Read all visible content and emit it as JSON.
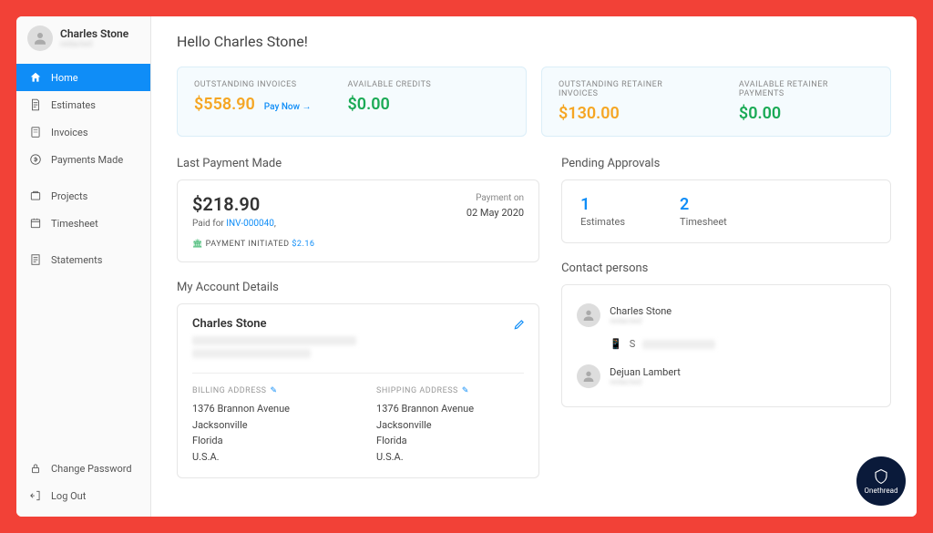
{
  "user": {
    "name": "Charles Stone",
    "subtitle": "—"
  },
  "nav": {
    "items": [
      {
        "label": "Home",
        "icon": "home",
        "active": true
      },
      {
        "label": "Estimates",
        "icon": "estimates"
      },
      {
        "label": "Invoices",
        "icon": "invoices"
      },
      {
        "label": "Payments Made",
        "icon": "payments"
      },
      {
        "label": "Projects",
        "icon": "projects"
      },
      {
        "label": "Timesheet",
        "icon": "timesheet"
      },
      {
        "label": "Statements",
        "icon": "statements"
      }
    ],
    "bottom": [
      {
        "label": "Change Password",
        "icon": "lock"
      },
      {
        "label": "Log Out",
        "icon": "logout"
      }
    ]
  },
  "greeting": "Hello Charles Stone!",
  "summary": {
    "card1": {
      "outstanding_label": "OUTSTANDING INVOICES",
      "outstanding_value": "$558.90",
      "paynow": "Pay Now →",
      "credits_label": "AVAILABLE CREDITS",
      "credits_value": "$0.00"
    },
    "card2": {
      "retainer_label": "OUTSTANDING RETAINER INVOICES",
      "retainer_value": "$130.00",
      "payments_label": "AVAILABLE RETAINER PAYMENTS",
      "payments_value": "$0.00"
    }
  },
  "last_payment": {
    "title": "Last Payment Made",
    "amount": "$218.90",
    "paid_for_prefix": "Paid for ",
    "paid_for_link": "INV-000040",
    "paid_for_suffix": ",",
    "initiated_label": "PAYMENT INITIATED",
    "initiated_amount": "$2.16",
    "payment_on_label": "Payment on",
    "payment_on_date": "02 May 2020"
  },
  "approvals": {
    "title": "Pending Approvals",
    "items": [
      {
        "count": "1",
        "label": "Estimates"
      },
      {
        "count": "2",
        "label": "Timesheet"
      }
    ]
  },
  "account": {
    "title": "My Account Details",
    "name": "Charles Stone",
    "billing_label": "BILLING ADDRESS",
    "shipping_label": "SHIPPING ADDRESS",
    "billing": {
      "line1": "1376 Brannon Avenue",
      "line2": "Jacksonville",
      "line3": "Florida",
      "line4": "U.S.A."
    },
    "shipping": {
      "line1": "1376 Brannon Avenue",
      "line2": "Jacksonville",
      "line3": "Florida",
      "line4": "U.S.A."
    }
  },
  "contacts": {
    "title": "Contact persons",
    "items": [
      {
        "name": "Charles Stone"
      },
      {
        "name": "Dejuan Lambert"
      }
    ]
  },
  "brand": "Onethread"
}
